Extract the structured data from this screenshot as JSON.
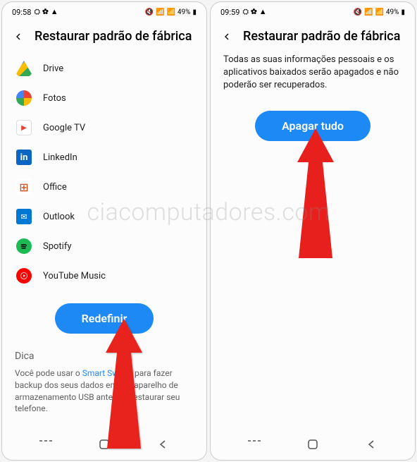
{
  "watermark": "ciacomputadores.com",
  "left": {
    "status": {
      "time": "09:58",
      "battery": "49%"
    },
    "title": "Restaurar padrão de fábrica",
    "apps": [
      {
        "name": "Drive",
        "icon": "drive-icon"
      },
      {
        "name": "Fotos",
        "icon": "photos-icon"
      },
      {
        "name": "Google TV",
        "icon": "googletv-icon"
      },
      {
        "name": "LinkedIn",
        "icon": "linkedin-icon"
      },
      {
        "name": "Office",
        "icon": "office-icon"
      },
      {
        "name": "Outlook",
        "icon": "outlook-icon"
      },
      {
        "name": "Spotify",
        "icon": "spotify-icon"
      },
      {
        "name": "YouTube Music",
        "icon": "ytmusic-icon"
      }
    ],
    "button": "Redefinir",
    "tip": {
      "title": "Dica",
      "pre": "Você pode usar o ",
      "link": "Smart Switch",
      "post": " para fazer backup dos seus dados em um aparelho de armazenamento USB antes de restaurar seu telefone."
    }
  },
  "right": {
    "status": {
      "time": "09:59",
      "battery": "49%"
    },
    "title": "Restaurar padrão de fábrica",
    "info": "Todas as suas informações pessoais e os aplicativos baixados serão apagados e não poderão ser recuperados.",
    "button": "Apagar tudo"
  }
}
